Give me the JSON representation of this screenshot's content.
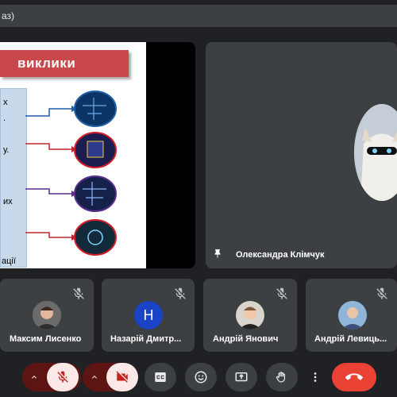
{
  "meeting": {
    "title_fragment": "аз)"
  },
  "slide": {
    "title": "виклики",
    "left_fragments": [
      "х",
      ".",
      "у.",
      "их",
      "ації"
    ]
  },
  "main_tile": {
    "name": "Олександра Клімчук"
  },
  "participants": [
    {
      "name": "Максим Лисенко",
      "avatar_type": "photo"
    },
    {
      "name": "Назарій Дмитр...",
      "avatar_type": "letter",
      "avatar_letter": "H",
      "avatar_color": "#1a43c6"
    },
    {
      "name": "Андрій Янович",
      "avatar_type": "photo"
    },
    {
      "name": "Андрій Левиць...",
      "avatar_type": "photo"
    }
  ],
  "controls": [
    {
      "name": "mic-options",
      "icon": "chevron-up-icon"
    },
    {
      "name": "mic-toggle",
      "icon": "mic-off-icon",
      "state": "off"
    },
    {
      "name": "camera-options",
      "icon": "chevron-up-icon"
    },
    {
      "name": "camera-toggle",
      "icon": "camera-off-icon",
      "state": "off"
    },
    {
      "name": "captions",
      "icon": "closed-captions-icon"
    },
    {
      "name": "reactions",
      "icon": "emoji-icon"
    },
    {
      "name": "present",
      "icon": "present-screen-icon"
    },
    {
      "name": "raise-hand",
      "icon": "hand-icon"
    },
    {
      "name": "more-options",
      "icon": "more-vert-icon"
    },
    {
      "name": "leave-call",
      "icon": "end-call-icon"
    }
  ],
  "colors": {
    "background": "#202124",
    "tile": "#3c4043",
    "accent_red": "#ea4335",
    "muted_bg": "#fce8e6",
    "slide_header": "#c9484c"
  }
}
